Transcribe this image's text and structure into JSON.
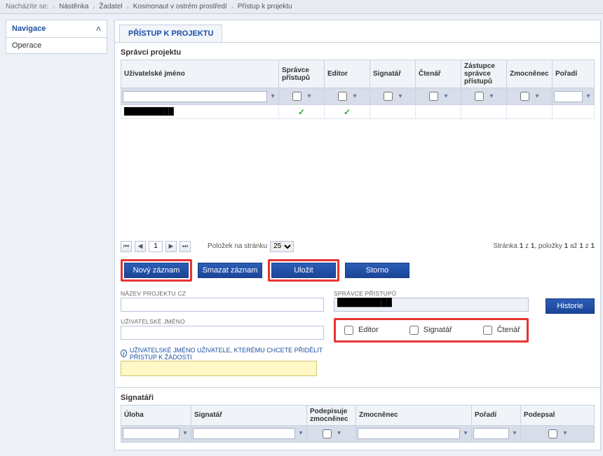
{
  "breadcrumb": {
    "label": "Nacházíte se:",
    "items": [
      "Nástěnka",
      "Žadatel",
      "Kosmonaut v ostrém prostředí",
      "Přístup k projektu"
    ]
  },
  "sidebar": {
    "nav_label": "Navigace",
    "ops_label": "Operace"
  },
  "page": {
    "title": "PŘÍSTUP K PROJEKTU"
  },
  "admins": {
    "section_title": "Správci projektu",
    "cols": {
      "username": "Uživatelské jméno",
      "access_admin": "Správce přístupů",
      "editor": "Editor",
      "signatory": "Signatář",
      "reader": "Čtenář",
      "deputy": "Zástupce správce přístupů",
      "proxy": "Zmocněnec",
      "order": "Pořadí"
    },
    "rows": [
      {
        "username": "██████████",
        "access_admin": true,
        "editor": true,
        "signatory": false,
        "reader": false,
        "deputy": false,
        "proxy": false,
        "order": ""
      }
    ],
    "pager": {
      "items_per_page_label": "Položek na stránku",
      "items_per_page": "25",
      "page": "1",
      "summary_left": "Stránka",
      "summary_page": "1",
      "summary_of": "z",
      "summary_total_pages": "1",
      "summary_items": ", položky",
      "summary_from": "1",
      "summary_to_word": "až",
      "summary_to": "1",
      "summary_oftotal": "z",
      "summary_total": "1"
    }
  },
  "buttons": {
    "new": "Nový záznam",
    "delete": "Smazat záznam",
    "save": "Uložit",
    "cancel": "Storno",
    "history": "Historie"
  },
  "form": {
    "project_name_label": "NÁZEV PROJEKTU CZ",
    "project_name": "",
    "access_admin_label": "SPRÁVCE PŘÍSTUPŮ",
    "access_admin_value": "██████████",
    "username_label": "UŽIVATELSKÉ JMÉNO",
    "username": "",
    "roles": {
      "editor": "Editor",
      "signatory": "Signatář",
      "reader": "Čtenář"
    },
    "hint": "UŽIVATELSKÉ JMÉNO UŽIVATELE, KTERÉMU CHCETE PŘIDĚLIT PŘÍSTUP K ŽÁDOSTI"
  },
  "signatories": {
    "section_title": "Signatáři",
    "cols": {
      "role": "Úloha",
      "signatory": "Signatář",
      "signs_proxy": "Podepisuje zmocněnec",
      "proxy": "Zmocněnec",
      "order": "Pořadí",
      "signed": "Podepsal"
    }
  },
  "icons": {
    "funnel": "▾",
    "check": "✓",
    "chev_up": "˄",
    "first": "⏮",
    "prev": "◀",
    "next": "▶",
    "last": "⏭",
    "chevron_right": "›"
  }
}
